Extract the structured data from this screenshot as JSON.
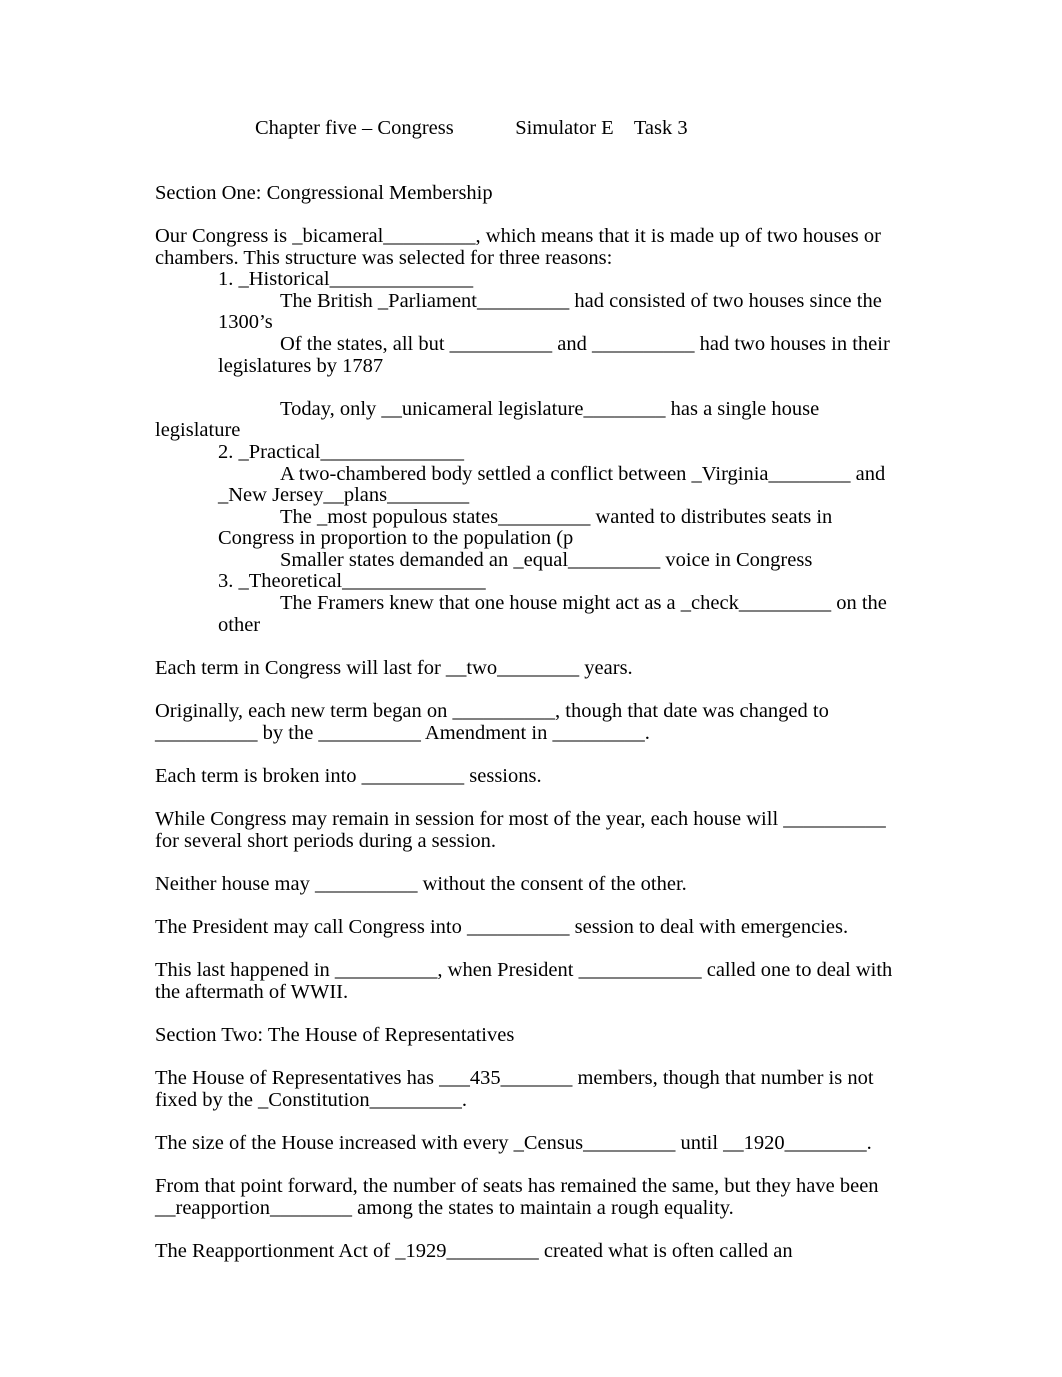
{
  "document": {
    "title_line": "Chapter five – Congress            Simulator E    Task 3",
    "section_one_heading": "Section One: Congressional Membership",
    "section_two_heading": "Section Two: The House of Representatives",
    "intro_paragraph": "Our Congress is _bicameral_________, which means that it is made up of two houses or chambers.    This structure was selected for three reasons:",
    "reasons": [
      {
        "number": "1. _Historical______________",
        "bullets": [
          "The British _Parliament_________ had consisted of two houses since the 1300’s",
          "Of the states, all but __________ and __________ had two houses in their legislatures by 1787",
          "Today, only __unicameral legislature________ has a single house legislature"
        ]
      },
      {
        "number": "2. _Practical______________",
        "bullets": [
          "A two-chambered body settled a conflict between _Virginia________ and _New Jersey__plans________",
          "The _most populous states_________ wanted to distributes seats in Congress in proportion to the population (p",
          "Smaller states demanded an _equal_________ voice in Congress"
        ]
      },
      {
        "number": "3. _Theoretical______________",
        "bullets": [
          "The Framers knew that one house might act as a _check_________ on the other"
        ]
      }
    ],
    "body_paragraphs": [
      "Each term in Congress will last for __two________ years.",
      "Originally, each new term began on __________, though that date was changed to __________ by the __________ Amendment in _________.",
      "Each term is broken into __________ sessions.",
      "While Congress may remain in session for most of the year, each house will __________ for several short periods during a session.",
      "Neither house may __________ without the consent of the other.",
      "The President may call Congress into __________ session to deal with emergencies.",
      "This last happened in __________, when President ____________ called one to deal with the aftermath of WWII."
    ],
    "section_two_paragraphs": [
      "The House of Representatives has ___435_______ members, though that number is not fixed by the _Constitution_________.",
      "The size of the House increased with every _Census_________ until __1920________.",
      "From that point forward, the number of seats has remained the same, but they have been __reapportion________ among the states to maintain a rough equality.",
      "The Reapportionment Act of _1929_________ created what is often called an"
    ]
  }
}
